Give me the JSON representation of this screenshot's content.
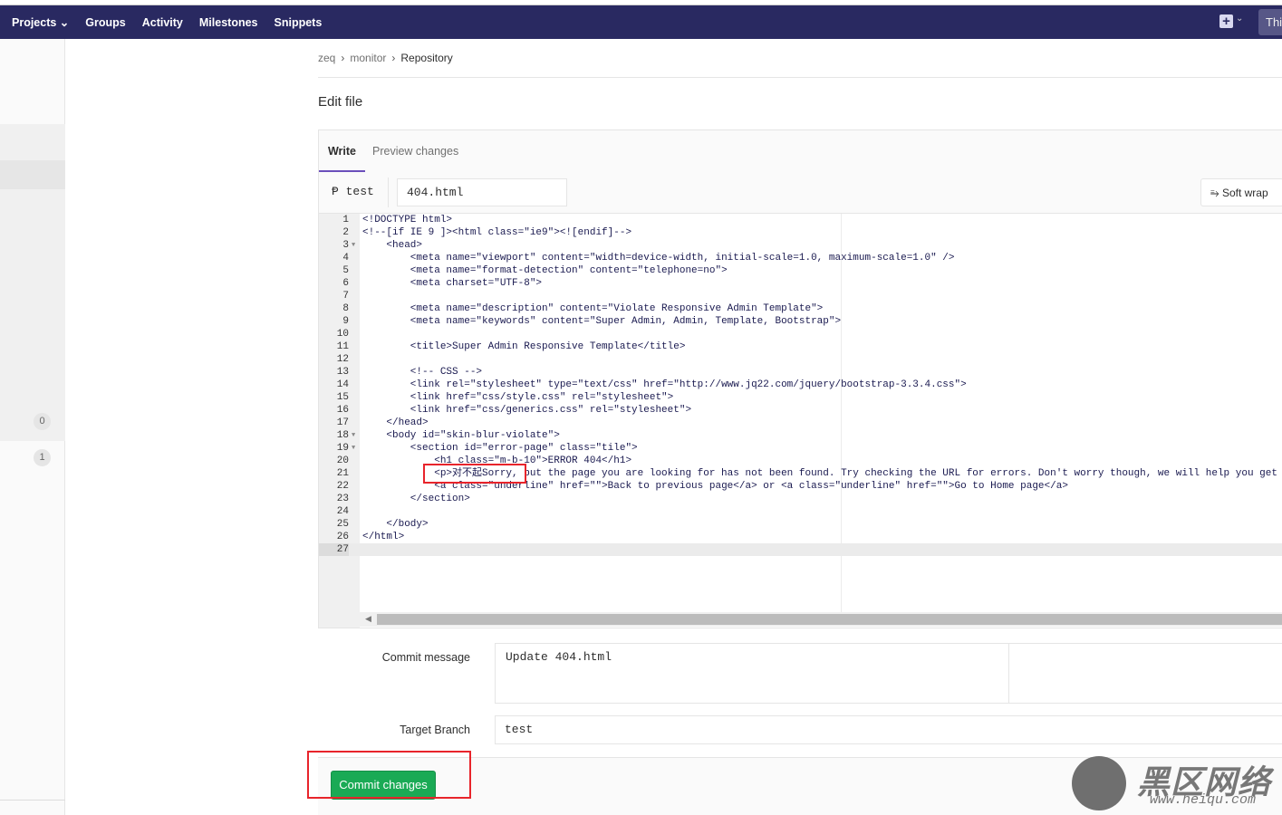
{
  "nav": {
    "items": [
      "Projects ⌄",
      "Groups",
      "Activity",
      "Milestones",
      "Snippets"
    ],
    "new_icon": "plus-square-icon",
    "search_placeholder": "This"
  },
  "sidebar": {
    "badges": [
      "0",
      "1"
    ]
  },
  "breadcrumb": {
    "items": [
      "zeq",
      "monitor",
      "Repository"
    ]
  },
  "page_title": "Edit file",
  "tabs": {
    "write": "Write",
    "preview": "Preview changes"
  },
  "file": {
    "branch": "test",
    "name": "404.html",
    "soft_wrap": "Soft wrap"
  },
  "editor": {
    "active_line": 27,
    "fold_lines": [
      3,
      18,
      19
    ],
    "lines": [
      "<!DOCTYPE html>",
      "<!--[if IE 9 ]><html class=\"ie9\"><![endif]-->",
      "    <head>",
      "        <meta name=\"viewport\" content=\"width=device-width, initial-scale=1.0, maximum-scale=1.0\" />",
      "        <meta name=\"format-detection\" content=\"telephone=no\">",
      "        <meta charset=\"UTF-8\">",
      "",
      "        <meta name=\"description\" content=\"Violate Responsive Admin Template\">",
      "        <meta name=\"keywords\" content=\"Super Admin, Admin, Template, Bootstrap\">",
      "",
      "        <title>Super Admin Responsive Template</title>",
      "",
      "        <!-- CSS -->",
      "        <link rel=\"stylesheet\" type=\"text/css\" href=\"http://www.jq22.com/jquery/bootstrap-3.3.4.css\">",
      "        <link href=\"css/style.css\" rel=\"stylesheet\">",
      "        <link href=\"css/generics.css\" rel=\"stylesheet\">",
      "    </head>",
      "    <body id=\"skin-blur-violate\">",
      "        <section id=\"error-page\" class=\"tile\">",
      "            <h1 class=\"m-b-10\">ERROR 404</h1>",
      "            <p>对不起Sorry, but the page you are looking for has not been found. Try checking the URL for errors. Don't worry though, we will help you get",
      "            <a class=\"underline\" href=\"\">Back to previous page</a> or <a class=\"underline\" href=\"\">Go to Home page</a>",
      "        </section>",
      "",
      "    </body>",
      "</html>",
      ""
    ]
  },
  "commit": {
    "message_label": "Commit message",
    "message_value": "Update 404.html",
    "branch_label": "Target Branch",
    "branch_value": "test",
    "button": "Commit changes"
  },
  "watermark": {
    "text": "黑区网络",
    "url": "www.heiqu.com"
  },
  "colors": {
    "nav": "#292961",
    "commit": "#1aaa55",
    "highlight": "#e8242b",
    "tab_active": "#6b4fbb"
  }
}
